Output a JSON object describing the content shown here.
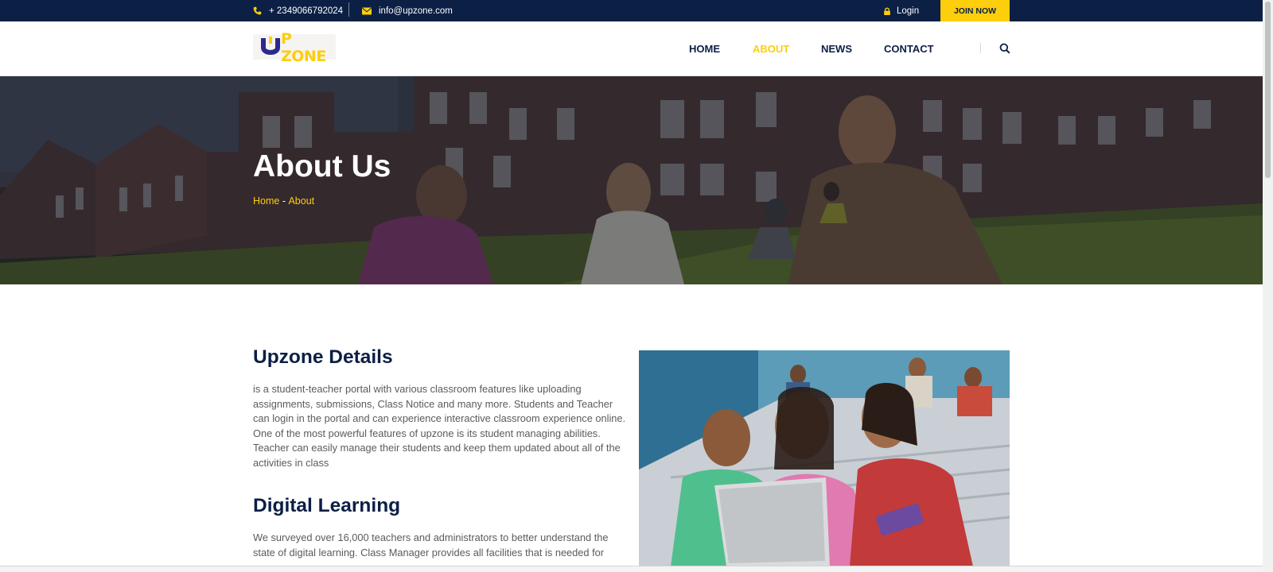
{
  "topbar": {
    "phone": "+ 2349066792024",
    "email": "info@upzone.com",
    "login": "Login",
    "join": "JOIN NOW",
    "icons": {
      "phone": "phone-icon",
      "email": "envelope-icon",
      "login": "lock-icon"
    }
  },
  "header": {
    "logo_text": "P ZONE",
    "nav": {
      "home": "HOME",
      "about": "ABOUT",
      "news": "NEWS",
      "contact": "CONTACT"
    },
    "active_nav": "ABOUT",
    "search_icon": "search-icon"
  },
  "hero": {
    "title": "About Us",
    "breadcrumb": {
      "home": "Home",
      "separator": " - ",
      "current": "About"
    }
  },
  "content": {
    "details_title": "Upzone Details",
    "details_text": "is a student-teacher portal with various classroom features like uploading assignments, submissions, Class Notice and many more. Students and Teacher can login in the portal and can experience interactive classroom experience online. One of the most powerful features of upzone is its student managing abilities. Teacher can easily manage their students and keep them updated about all of the activities in class",
    "digital_title": "Digital Learning",
    "digital_text": "We surveyed over 16,000 teachers and administrators to better understand the state of digital learning. Class Manager provides all facilities that is needed for"
  },
  "colors": {
    "navy": "#0c1f45",
    "accent": "#fcce0c",
    "text": "#5b5b5b"
  }
}
